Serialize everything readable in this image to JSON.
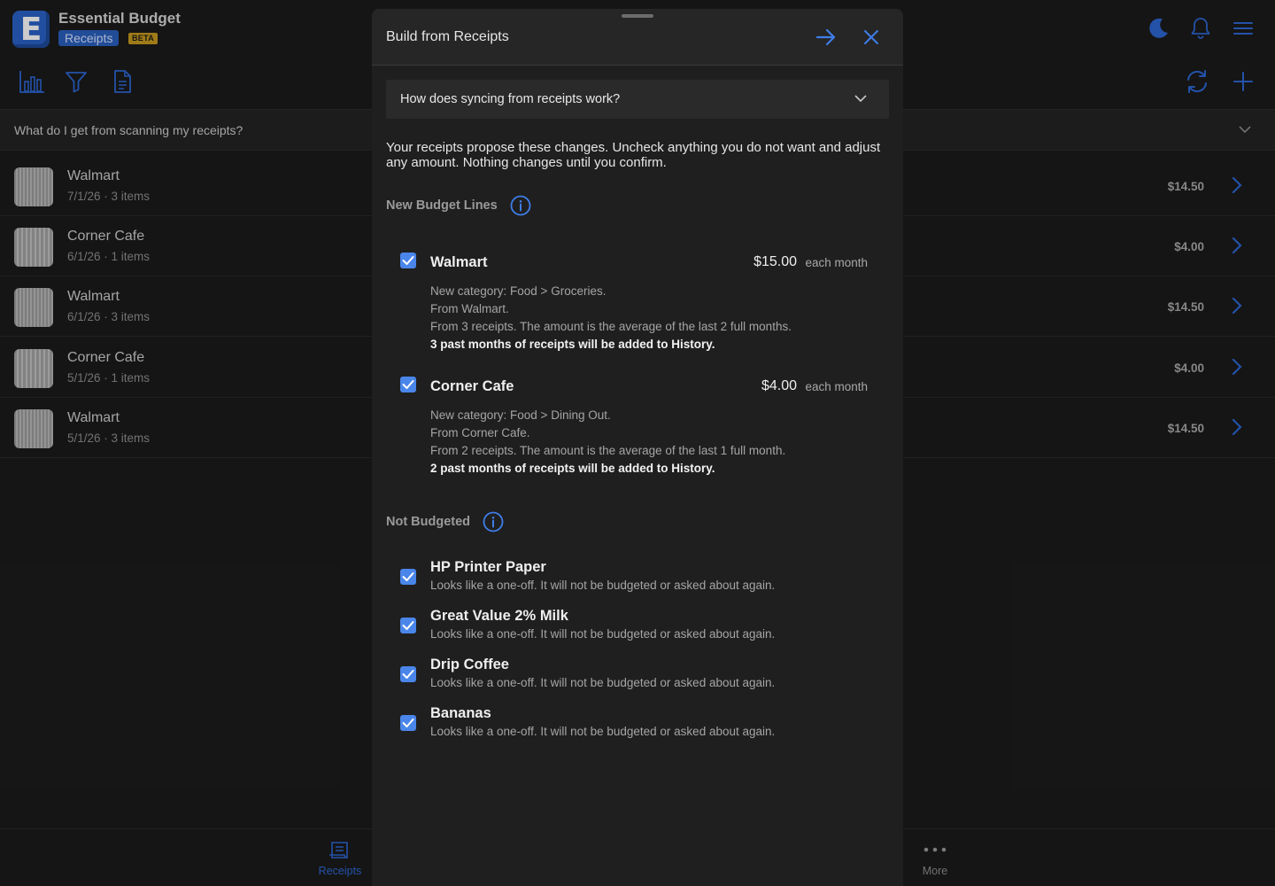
{
  "app": {
    "name": "Essential Budget",
    "logo_letter": "E",
    "section": "Receipts",
    "beta": "BETA",
    "accent": "#3f7de8"
  },
  "faq_bar": {
    "text": "What do I get from scanning my receipts?"
  },
  "receipts": [
    {
      "store": "Walmart",
      "meta": "7/1/26 · 3 items",
      "amount": "$14.50"
    },
    {
      "store": "Corner Cafe",
      "meta": "6/1/26 · 1 items",
      "amount": "$4.00"
    },
    {
      "store": "Walmart",
      "meta": "6/1/26 · 3 items",
      "amount": "$14.50"
    },
    {
      "store": "Corner Cafe",
      "meta": "5/1/26 · 1 items",
      "amount": "$4.00"
    },
    {
      "store": "Walmart",
      "meta": "5/1/26 · 3 items",
      "amount": "$14.50"
    }
  ],
  "tabbar": {
    "receipts_label": "Receipts",
    "more_label": "More"
  },
  "modal": {
    "title": "Build from Receipts",
    "how_question": "How does syncing from receipts work?",
    "intro": "Your receipts propose these changes. Uncheck anything you do not want and adjust any amount. Nothing changes until you confirm.",
    "new_lines_title": "New Budget Lines",
    "not_budgeted_title": "Not Budgeted",
    "budget_lines": [
      {
        "name": "Walmart",
        "checked": true,
        "amount": "$15.00",
        "frequency": "each month",
        "category": "New category: Food > Groceries.",
        "source": "From Walmart.",
        "basis": "From 3 receipts. The amount is the average of the last 2 full months.",
        "history": "3 past months of receipts will be added to History."
      },
      {
        "name": "Corner Cafe",
        "checked": true,
        "amount": "$4.00",
        "frequency": "each month",
        "category": "New category: Food > Dining Out.",
        "source": "From Corner Cafe.",
        "basis": "From 2 receipts. The amount is the average of the last 1 full month.",
        "history": "2 past months of receipts will be added to History."
      }
    ],
    "not_budgeted": [
      {
        "name": "HP Printer Paper",
        "checked": true,
        "desc": "Looks like a one-off. It will not be budgeted or asked about again."
      },
      {
        "name": "Great Value 2% Milk",
        "checked": true,
        "desc": "Looks like a one-off. It will not be budgeted or asked about again."
      },
      {
        "name": "Drip Coffee",
        "checked": true,
        "desc": "Looks like a one-off. It will not be budgeted or asked about again."
      },
      {
        "name": "Bananas",
        "checked": true,
        "desc": "Looks like a one-off. It will not be budgeted or asked about again."
      }
    ]
  }
}
